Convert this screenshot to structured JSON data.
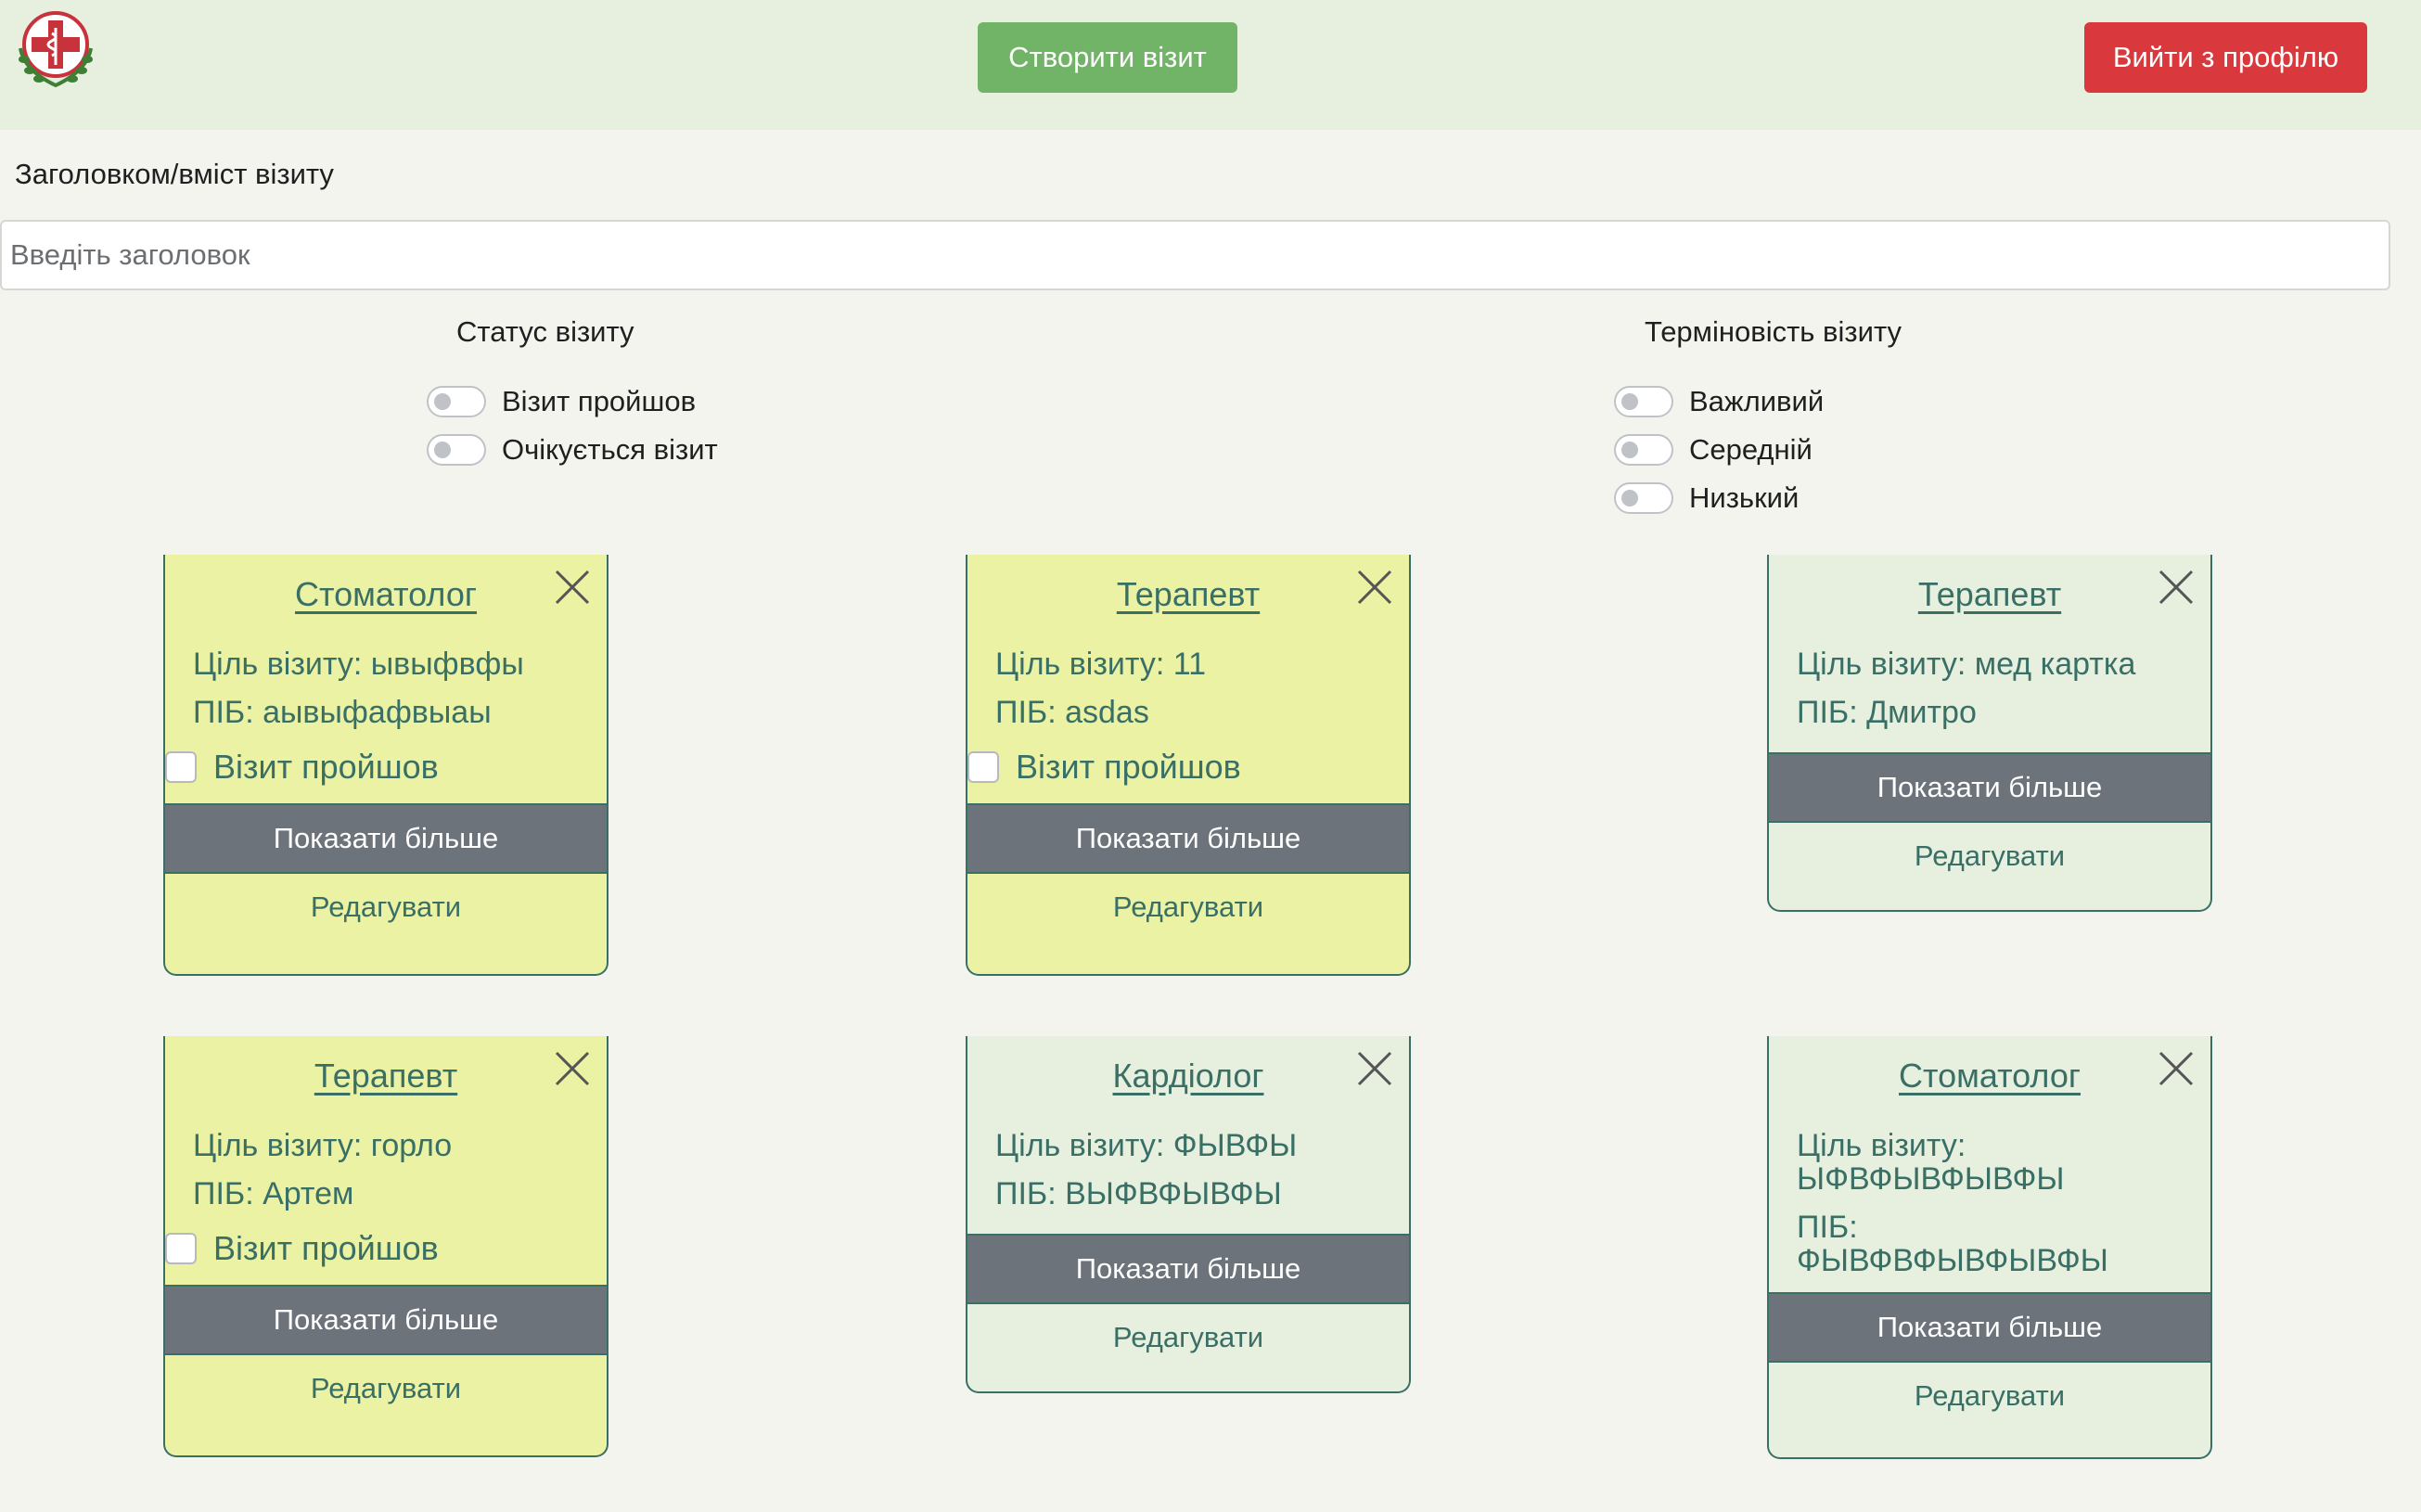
{
  "header": {
    "create_label": "Створити візит",
    "logout_label": "Вийти з профілю"
  },
  "search": {
    "label": "Заголовком/вміст візиту",
    "placeholder": "Введіть заголовок",
    "value": ""
  },
  "filters": {
    "status": {
      "title": "Статус візиту",
      "options": [
        "Візит пройшов",
        "Очікується візит"
      ]
    },
    "urgency": {
      "title": "Терміновість візиту",
      "options": [
        "Важливий",
        "Середній",
        "Низький"
      ]
    }
  },
  "cards": [
    {
      "title": "Стоматолог",
      "purpose": "Ціль візиту: ывыфвфы",
      "name": "ПІБ: аывыфафвыаы",
      "done_label": "Візит пройшов",
      "more_label": "Показати більше",
      "edit_label": "Редагувати"
    },
    {
      "title": "Терапевт",
      "purpose": "Ціль візиту: 11",
      "name": "ПІБ: asdas",
      "done_label": "Візит пройшов",
      "more_label": "Показати більше",
      "edit_label": "Редагувати"
    },
    {
      "title": "Терапевт",
      "purpose": "Ціль візиту: мед картка",
      "name": "ПІБ: Дмитро",
      "more_label": "Показати більше",
      "edit_label": "Редагувати"
    },
    {
      "title": "Терапевт",
      "purpose": "Ціль візиту: горло",
      "name": "ПІБ: Артем",
      "done_label": "Візит пройшов",
      "more_label": "Показати більше",
      "edit_label": "Редагувати"
    },
    {
      "title": "Кардіолог",
      "purpose": "Ціль візиту: ФЫВФЫ",
      "name": "ПІБ: ВЫФВФЫВФЫ",
      "more_label": "Показати більше",
      "edit_label": "Редагувати"
    },
    {
      "title": "Стоматолог",
      "purpose_label": "Ціль візиту:",
      "purpose_value": "ЫФВФЫВФЫВФЫ",
      "name_label": "ПІБ:",
      "name_value": "ФЫВФВФЫВФЫВФЫ",
      "more_label": "Показати більше",
      "edit_label": "Редагувати"
    }
  ],
  "colors": {
    "header_bg": "#e7f0df",
    "page_bg": "#f3f4ee",
    "create_button": "#72b467",
    "logout_button": "#d9383d",
    "card_yellow": "#ebf2a3",
    "card_green": "#e7f0df",
    "card_text": "#3a6f66",
    "more_button": "#6d737b"
  }
}
